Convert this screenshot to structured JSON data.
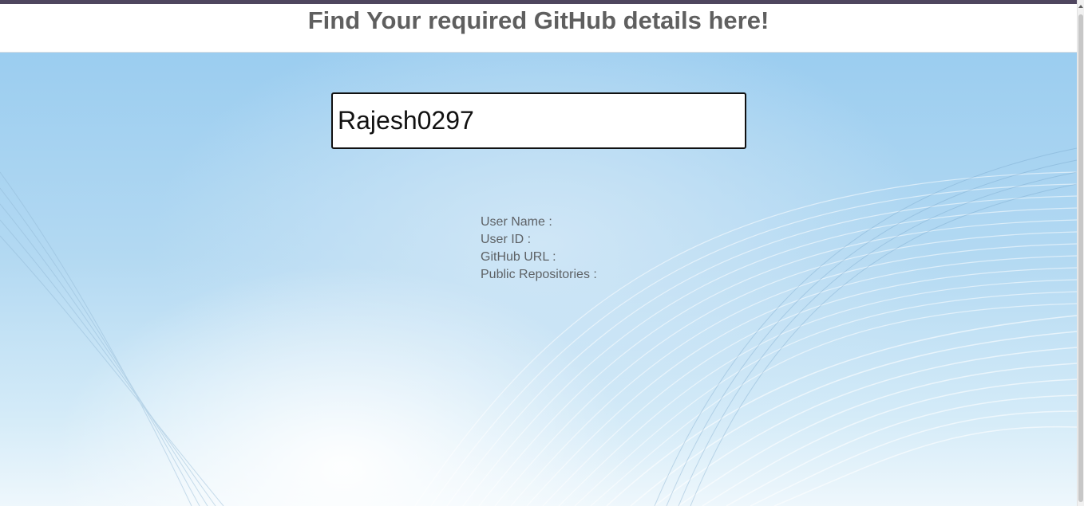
{
  "header": {
    "title": "Find Your required GitHub details here!"
  },
  "search": {
    "value": "Rajesh0297"
  },
  "details": {
    "user_name_label": "User Name :",
    "user_id_label": "User ID :",
    "github_url_label": "GitHub URL :",
    "public_repos_label": "Public Repositories :"
  },
  "colors": {
    "top_border": "#4f465f",
    "title_text": "#5f5f5f",
    "background_sky": "#9bcdf0"
  }
}
